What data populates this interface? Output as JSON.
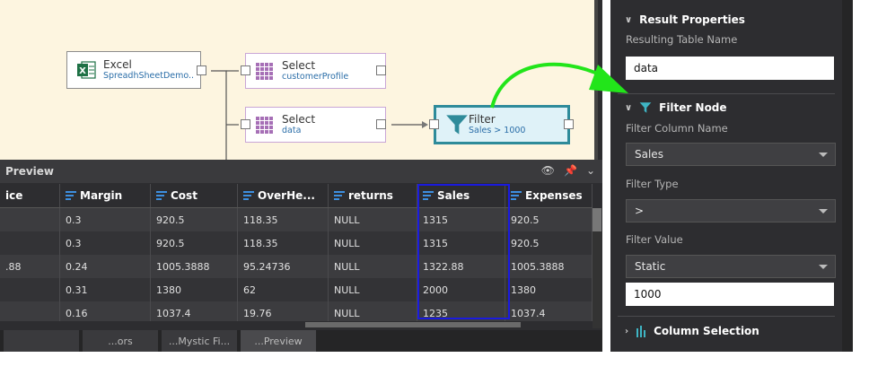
{
  "canvas": {
    "excel_node": {
      "title": "Excel",
      "subtitle": "SpreadhSheetDemo..."
    },
    "select_node_1": {
      "title": "Select",
      "subtitle": "customerProfile"
    },
    "select_node_2": {
      "title": "Select",
      "subtitle": "data"
    },
    "filter_node": {
      "title": "Filter",
      "subtitle": "Sales > 1000"
    }
  },
  "preview": {
    "title": "Preview",
    "columns": [
      "ice",
      "Margin",
      "Cost",
      "OverHe...",
      "returns",
      "Sales",
      "Expenses"
    ],
    "rows": [
      [
        "",
        "0.3",
        "920.5",
        "118.35",
        "NULL",
        "1315",
        "920.5"
      ],
      [
        "",
        "0.3",
        "920.5",
        "118.35",
        "NULL",
        "1315",
        "920.5"
      ],
      [
        ".88",
        "0.24",
        "1005.3888",
        "95.24736",
        "NULL",
        "1322.88",
        "1005.3888"
      ],
      [
        "",
        "0.31",
        "1380",
        "62",
        "NULL",
        "2000",
        "1380"
      ],
      [
        "",
        "0.16",
        "1037.4",
        "19.76",
        "NULL",
        "1235",
        "1037.4"
      ]
    ],
    "bottom_tabs": [
      "",
      "...ors",
      "...Mystic Fi...",
      "...Preview"
    ]
  },
  "properties": {
    "result_section": "Result Properties",
    "table_name_label": "Resulting Table Name",
    "table_name_value": "data",
    "filter_section": "Filter Node",
    "filter_column_label": "Filter Column Name",
    "filter_column_value": "Sales",
    "filter_type_label": "Filter Type",
    "filter_type_value": ">",
    "filter_value_label": "Filter Value",
    "filter_value_mode": "Static",
    "filter_value": "1000",
    "column_selection_section": "Column Selection"
  },
  "colors": {
    "highlight_box": "#1a1adf",
    "annotation_arrow": "#22e51a",
    "filter_accent": "#2e8b9a"
  }
}
